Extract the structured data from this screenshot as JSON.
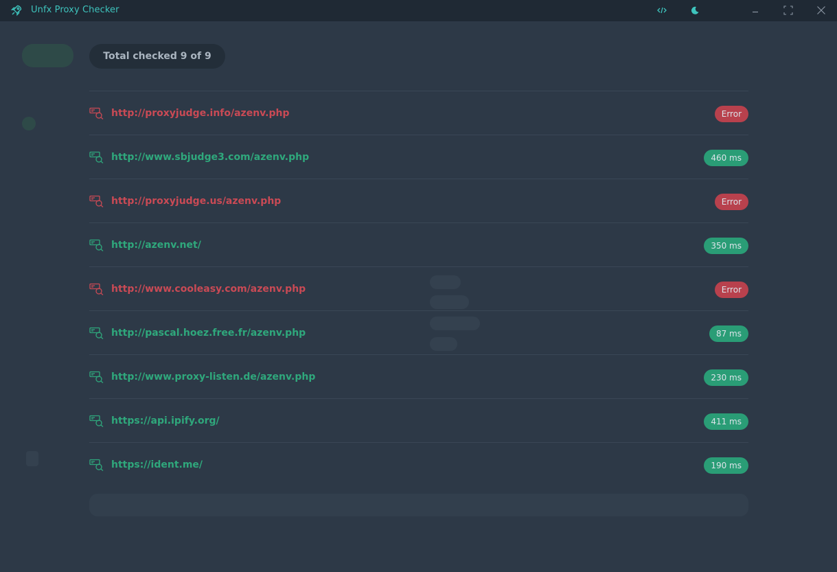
{
  "window": {
    "title": "Unfx Proxy Checker",
    "icons": {
      "app": "rocket-icon",
      "code": "code-icon",
      "theme": "moon-icon",
      "minimize": "minimize-icon",
      "maximize": "maximize-icon",
      "close": "close-icon"
    }
  },
  "overlay": {
    "total_label": "Total checked 9 of 9"
  },
  "colors": {
    "ok": "#2a9d76",
    "error": "#b8414d",
    "accent": "#3ec4bd"
  },
  "judges": [
    {
      "url": "http://proxyjudge.info/azenv.php",
      "status": "error",
      "badge": "Error"
    },
    {
      "url": "http://www.sbjudge3.com/azenv.php",
      "status": "ok",
      "badge": "460 ms"
    },
    {
      "url": "http://proxyjudge.us/azenv.php",
      "status": "error",
      "badge": "Error"
    },
    {
      "url": "http://azenv.net/",
      "status": "ok",
      "badge": "350 ms"
    },
    {
      "url": "http://www.cooleasy.com/azenv.php",
      "status": "error",
      "badge": "Error"
    },
    {
      "url": "http://pascal.hoez.free.fr/azenv.php",
      "status": "ok",
      "badge": "87 ms"
    },
    {
      "url": "http://www.proxy-listen.de/azenv.php",
      "status": "ok",
      "badge": "230 ms"
    },
    {
      "url": "https://api.ipify.org/",
      "status": "ok",
      "badge": "411 ms"
    },
    {
      "url": "https://ident.me/",
      "status": "ok",
      "badge": "190 ms"
    }
  ]
}
